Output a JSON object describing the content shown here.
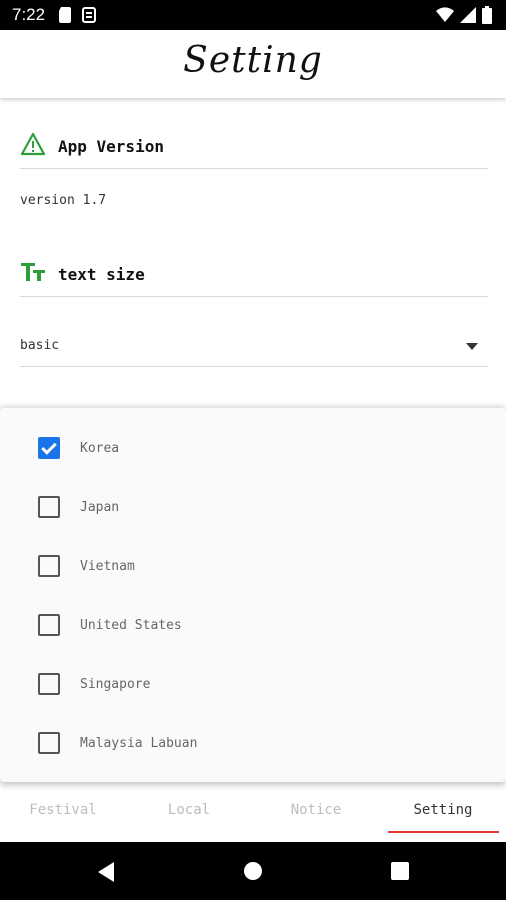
{
  "status_bar": {
    "time": "7:22",
    "left_icons": [
      "sd-card-icon",
      "signal-app-icon"
    ],
    "right_icons": [
      "wifi-icon",
      "cell-signal-icon",
      "battery-icon"
    ]
  },
  "app_bar": {
    "title": "Setting"
  },
  "sections": {
    "app_version": {
      "label": "App Version",
      "icon": "warning-triangle-icon",
      "icon_color": "#2e9e3a",
      "value": "version 1.7"
    },
    "text_size": {
      "label": "text size",
      "icon": "text-size-icon",
      "icon_color": "#2e9e3a",
      "selected": "basic"
    }
  },
  "countries": [
    {
      "label": "Korea",
      "checked": true
    },
    {
      "label": "Japan",
      "checked": false
    },
    {
      "label": "Vietnam",
      "checked": false
    },
    {
      "label": "United States",
      "checked": false
    },
    {
      "label": "Singapore",
      "checked": false
    },
    {
      "label": "Malaysia Labuan",
      "checked": false
    }
  ],
  "tabs": [
    {
      "label": "Festival",
      "active": false
    },
    {
      "label": "Local",
      "active": false
    },
    {
      "label": "Notice",
      "active": false
    },
    {
      "label": "Setting",
      "active": true
    }
  ],
  "colors": {
    "accent": "#1a73e8",
    "tab_indicator": "#e53935",
    "section_icon": "#2e9e3a"
  },
  "nav_bar": {
    "buttons": [
      "back-icon",
      "home-icon",
      "recents-icon"
    ]
  }
}
